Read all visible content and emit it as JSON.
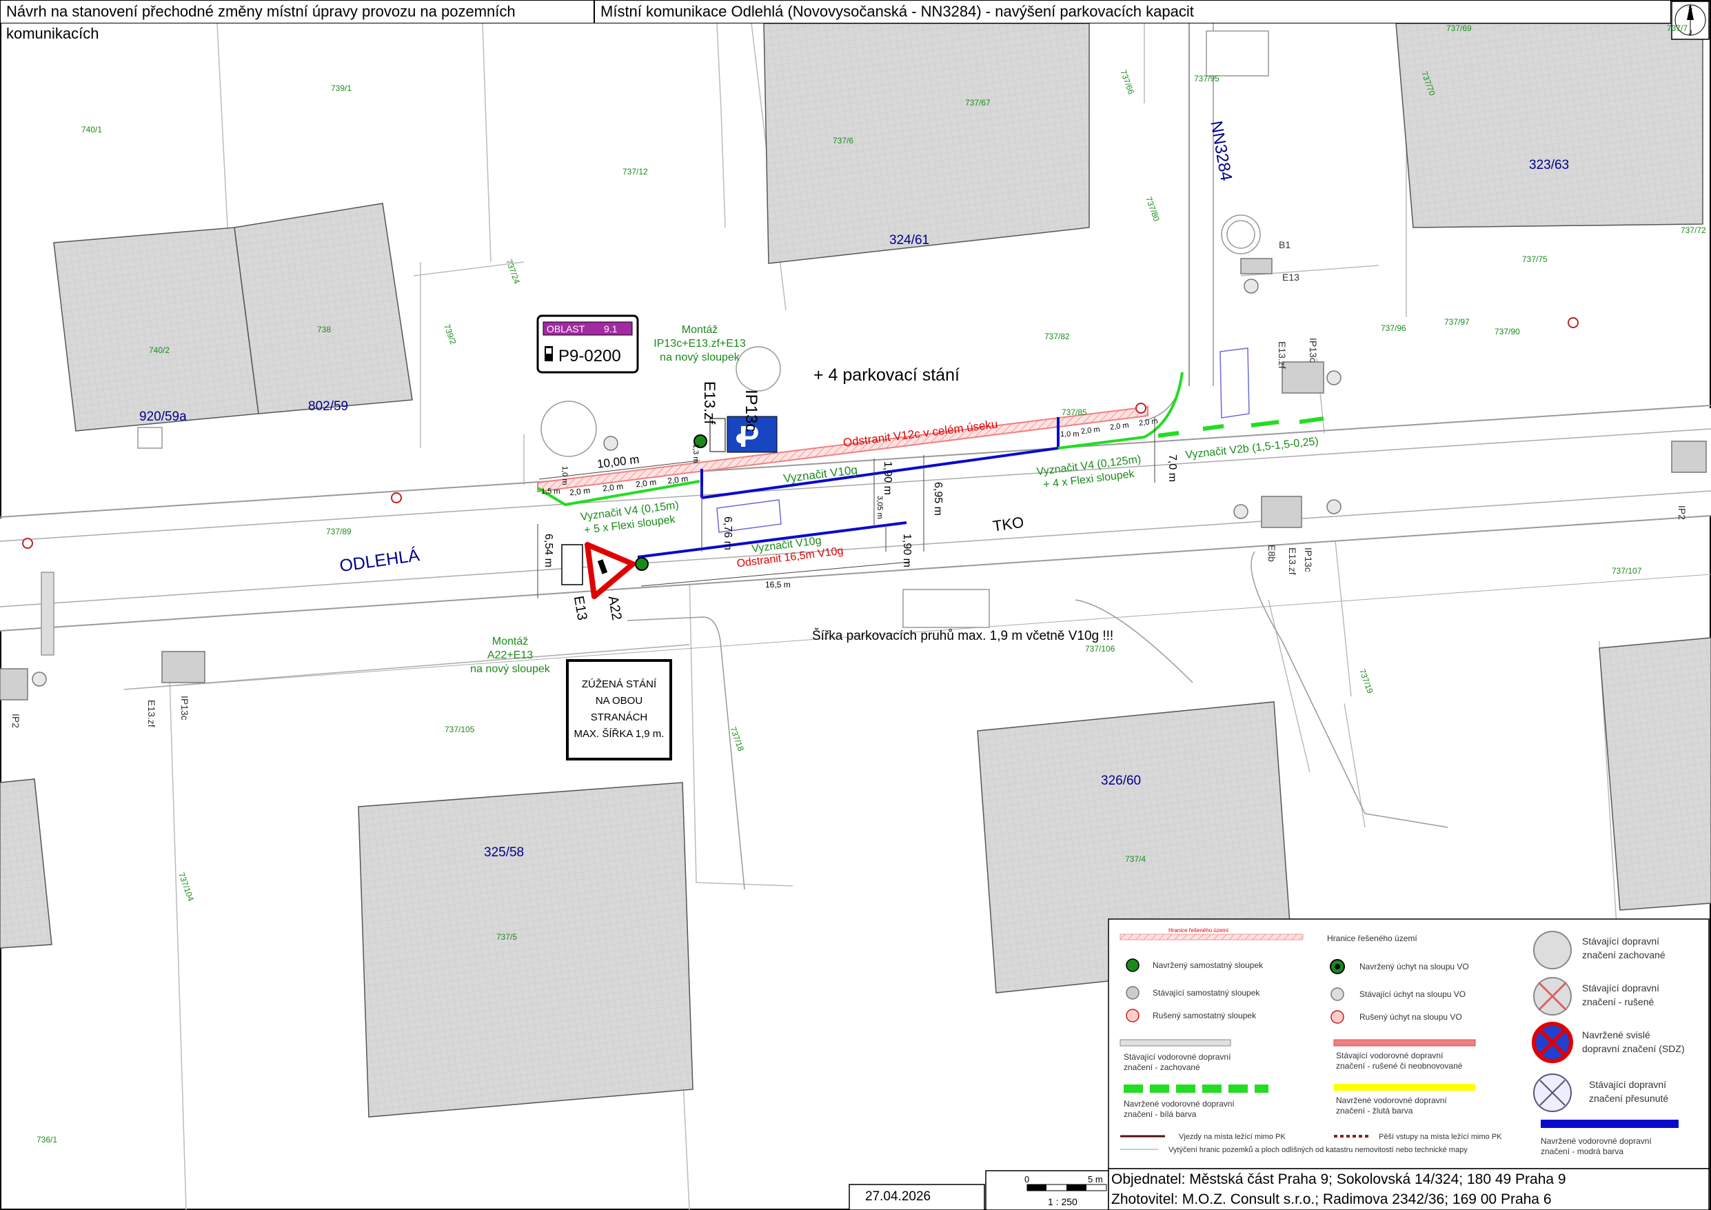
{
  "header": {
    "title_left": "Návrh na stanovení přechodné změny místní úpravy provozu na pozemních komunikacích",
    "title_right": "Místní komunikace Odlehlá (Novovysočanská - NN3284) - navýšení parkovacích kapacit"
  },
  "compass": {
    "letters": [
      "S",
      "J"
    ]
  },
  "parcels": {
    "p739_1": "739/1",
    "p740_1": "740/1",
    "p737_12": "737/12",
    "p737_67": "737/67",
    "p737_6": "737/6",
    "p737_66": "737/66",
    "p737_80": "737/80",
    "p737_24": "737/24",
    "p739_2": "739/2",
    "p740_2": "740/2",
    "p738": "738",
    "p737_82": "737/82",
    "p737_95": "737/95",
    "p737_69": "737/69",
    "p737_7": "737/7",
    "p737_70": "737/70",
    "p737_75": "737/75",
    "p737_72": "737/72",
    "p737_96": "737/96",
    "p737_97": "737/97",
    "p737_90": "737/90",
    "p737_85": "737/85",
    "p737_89": "737/89",
    "p737_107": "737/107",
    "p737_106": "737/106",
    "p737_19": "737/19",
    "p737_105": "737/105",
    "p737_18": "737/18",
    "p737_104": "737/104",
    "p737_5": "737/5",
    "p737_4": "737/4",
    "p736_1": "736/1"
  },
  "parcels_major": {
    "p324_61": "324/61",
    "p323_63": "323/63",
    "p920_59a": "920/59a",
    "p802_59": "802/59",
    "p325_58": "325/58",
    "p326_60": "326/60"
  },
  "streets": {
    "odlehla": "ODLEHLÁ",
    "nn3284": "NN3284",
    "tko": "TKO"
  },
  "sign_zone": {
    "oblast": "OBLAST",
    "oblast_num": "9.1",
    "code": "P9-0200"
  },
  "annotations": {
    "montaz_top": [
      "Montáž",
      "IP13c+E13.zf+E13",
      "na nový sloupek"
    ],
    "plus_parking": "+ 4 parkovací stání",
    "odstranit_v12c": "Odstranit V12c v celém úseku",
    "vyznacit_v10g_top": "Vyznačit V10g",
    "vyznacit_v4_left": [
      "Vyznačit V4 (0,15m)",
      "+ 5 x Flexi sloupek"
    ],
    "vyznacit_v4_right": [
      "Vyznačit V4 (0,125m)",
      "+ 4 x Flexi sloupek"
    ],
    "vyznacit_v2b": "Vyznačit V2b (1,5-1,5-0,25)",
    "vyznacit_v10g_bottom": "Vyznačit V10g",
    "odstranit_v10g": "Odstranit 16,5m V10g",
    "montaz_bottom": [
      "Montáž",
      "A22+E13",
      "na nový sloupek"
    ],
    "sirka": "Šířka parkovacích pruhů max. 1,9 m včetně V10g !!!",
    "sign_ip13c": "IP13c",
    "sign_e13zf": "E13.zf",
    "sign_a22": "A22",
    "sign_e13": "E13",
    "b1": "B1",
    "e13_top": "E13",
    "e13zf_right": "E13.zf",
    "ip13c_right": "IP13c",
    "e8b": "E8b",
    "e13zf_right2": "E13.zf",
    "ip13c_right2": "IP13c",
    "ip2": "IP2",
    "e13zf_left": "E13.zf",
    "ip13c_left": "IP13c",
    "ip2_left": "IP2"
  },
  "dimensions": {
    "d10": "10,00 m",
    "d20a": "2,0 m",
    "d20b": "2,0 m",
    "d20c": "2,0 m",
    "d20d": "2,0 m",
    "d15": "1,5 m",
    "d10v": "1,0 m",
    "d13": "1,3 m",
    "d190a": "1,90 m",
    "d305": "3,05 m",
    "d695": "6,95 m",
    "d676": "6,76 m",
    "d654": "6,54 m",
    "d190b": "1,90 m",
    "d165": "16,5 m",
    "d70": "7,0 m",
    "dr10": "1,0 m",
    "dr20a": "2,0 m",
    "dr20b": "2,0 m",
    "dr20c": "2,0 m"
  },
  "narrow_sign": [
    "ZÚŽENÁ STÁNÍ",
    "NA OBOU",
    "STRANÁCH",
    "MAX. ŠÍŘKA 1,9 m."
  ],
  "legend": {
    "hranice_small": "Hranice řešeného území",
    "hranice": "Hranice řešeného území",
    "navrzeny_sloupek": "Navržený samostatný sloupek",
    "stavajici_sloupek": "Stávající samostatný sloupek",
    "ruseny_sloupek": "Rušený samostatný sloupek",
    "navrzeny_uchyt": "Navržený úchyt na sloupu VO",
    "stavajici_uchyt": "Stávající úchyt na sloupu VO",
    "ruseny_uchyt": "Rušený úchyt na sloupu VO",
    "sdz_zachovane": [
      "Stávající dopravní",
      "značení zachované"
    ],
    "sdz_rusene": [
      "Stávající dopravní",
      "značení - rušené"
    ],
    "navrzene_svisle": [
      "Navržené svislé",
      "dopravní značení (SDZ)"
    ],
    "sdz_presunute": [
      "Stávající dopravní",
      "značení přesunuté"
    ],
    "vdz_zachovane": [
      "Stávající vodorovné dopravní",
      "značení - zachované"
    ],
    "vdz_rusene": [
      "Stávající vodorovné dopravní",
      "značení - rušené či neobnovované"
    ],
    "vdz_bila": [
      "Navržené vodorovné dopravní",
      "značení - bílá barva"
    ],
    "vdz_zluta": [
      "Navržené vodorovné dopravní",
      "značení - žlutá barva"
    ],
    "vdz_modra": [
      "Navržené vodorovné dopravní",
      "značení - modrá barva"
    ],
    "vjezdy": "Vjezdy na místa ležící mimo PK",
    "pesi": "Pěší vstupy na místa ležící mimo PK",
    "vytyceni": "Vytýčení hranic pozemků a ploch odlišných od katastru nemovitostí nebo technické mapy"
  },
  "footer": {
    "date": "27.04.2026",
    "scale_zero": "0",
    "scale_5m": "5 m",
    "scale": "1 : 250",
    "objednatel": "Objednatel: Městská část Praha 9; Sokolovská 14/324; 180 49 Praha 9",
    "zhotovitel": "Zhotovitel: M.O.Z. Consult s.r.o.; Radimova 2342/36; 169 00 Praha 6"
  },
  "colors": {
    "green_text": "#1a8a1a",
    "blue_text": "#00008b",
    "red_text": "#e00000",
    "building": "#d4d4d4",
    "blue_line": "#0a0acd",
    "green_line": "#22dd22",
    "red_band": "#f08080"
  }
}
